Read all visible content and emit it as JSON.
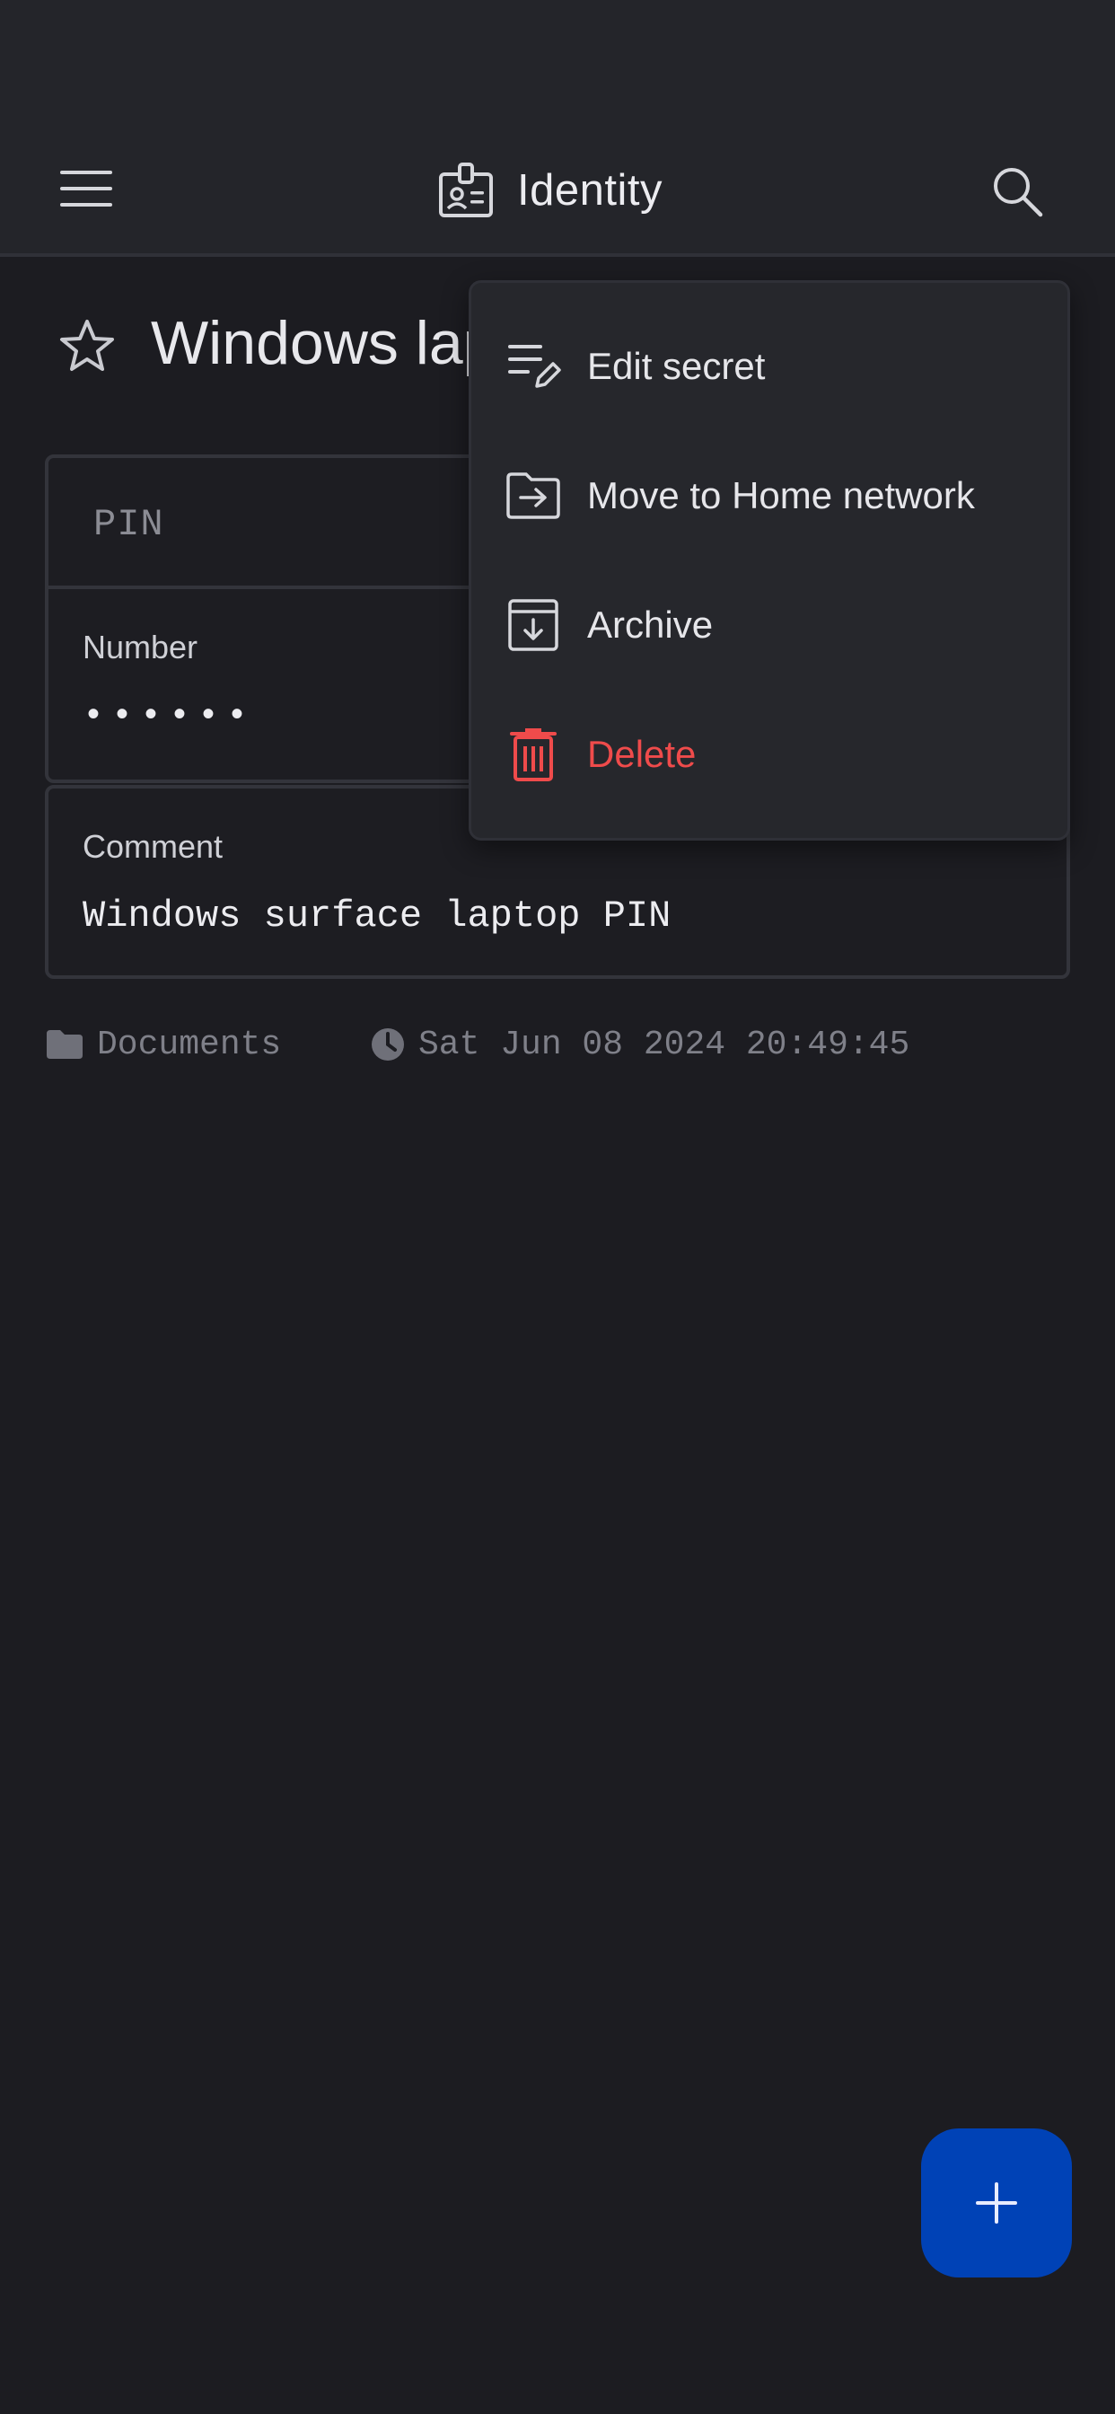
{
  "app_bar": {
    "title": "Identity",
    "menu_icon": "hamburger-menu-icon",
    "title_icon": "id-badge-icon",
    "search_icon": "search-icon"
  },
  "secret": {
    "title": "Windows laptop PIN",
    "favorite_icon": "star-outline-icon",
    "type": "PIN",
    "fields": {
      "number_label": "Number",
      "number_value": "••••••",
      "comment_label": "Comment",
      "comment_value": "Windows surface laptop PIN"
    },
    "meta": {
      "folder": "Documents",
      "folder_icon": "folder-icon",
      "timestamp": "Sat Jun 08 2024 20:49:45",
      "timestamp_icon": "clock-icon"
    }
  },
  "context_menu": {
    "items": [
      {
        "label": "Edit secret",
        "icon": "edit-note-icon"
      },
      {
        "label": "Move to Home network",
        "icon": "folder-move-icon"
      },
      {
        "label": "Archive",
        "icon": "archive-icon"
      },
      {
        "label": "Delete",
        "icon": "trash-icon",
        "color": "#ef4b4b"
      }
    ]
  },
  "fab": {
    "icon": "plus-icon",
    "color": "#0042b6"
  },
  "colors": {
    "background": "#1c1c21",
    "app_bar": "#24252a",
    "menu_bg": "#26272c",
    "danger": "#ef4b4b",
    "accent": "#0042b6"
  }
}
